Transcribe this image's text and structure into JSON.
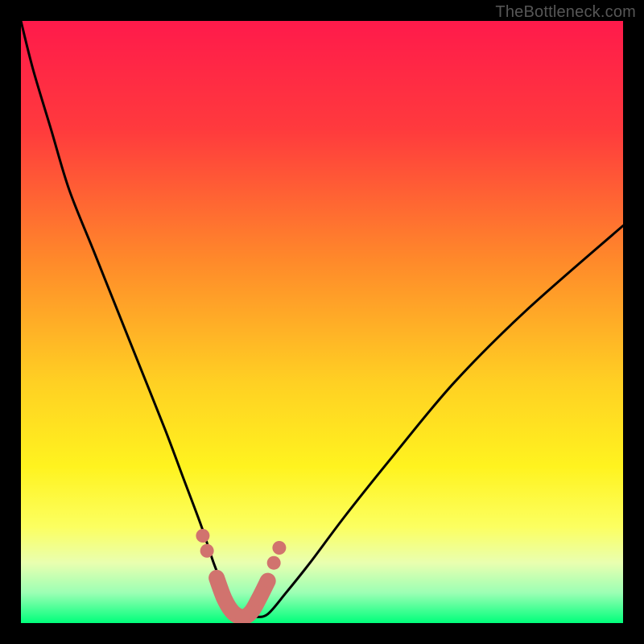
{
  "watermark": "TheBottleneck.com",
  "chart_data": {
    "type": "line",
    "title": "",
    "xlabel": "",
    "ylabel": "",
    "xlim": [
      0,
      100
    ],
    "ylim": [
      0,
      100
    ],
    "grid": false,
    "gradient_stops": [
      {
        "offset": 0,
        "color": "#ff1a4b"
      },
      {
        "offset": 18,
        "color": "#ff3a3d"
      },
      {
        "offset": 40,
        "color": "#ff8a2a"
      },
      {
        "offset": 60,
        "color": "#ffd023"
      },
      {
        "offset": 74,
        "color": "#fff31f"
      },
      {
        "offset": 84,
        "color": "#fcff60"
      },
      {
        "offset": 90,
        "color": "#e9ffb0"
      },
      {
        "offset": 95,
        "color": "#9bffb4"
      },
      {
        "offset": 100,
        "color": "#00ff7b"
      }
    ],
    "series": [
      {
        "name": "bottleneck-curve",
        "color": "#000000",
        "x": [
          0,
          2,
          5,
          8,
          12,
          16,
          20,
          24,
          27,
          30,
          32,
          34,
          35.5,
          37,
          39,
          41,
          44,
          48,
          54,
          62,
          72,
          84,
          100
        ],
        "y": [
          100,
          92,
          82,
          72,
          62,
          52,
          42,
          32,
          24,
          16,
          10,
          5,
          1.5,
          1,
          1,
          1.5,
          5,
          10,
          18,
          28,
          40,
          52,
          66
        ]
      },
      {
        "name": "marker-dots",
        "color": "#d1736e",
        "type": "scatter",
        "x": [
          30.2,
          30.9,
          32.5,
          33.8,
          35.2,
          36.8,
          38.2,
          39.5,
          41.0,
          42.0,
          42.9
        ],
        "y": [
          14.5,
          12.0,
          7.5,
          4.0,
          1.8,
          1.0,
          1.8,
          4.0,
          7.0,
          10.0,
          12.5
        ]
      }
    ],
    "annotations": []
  }
}
